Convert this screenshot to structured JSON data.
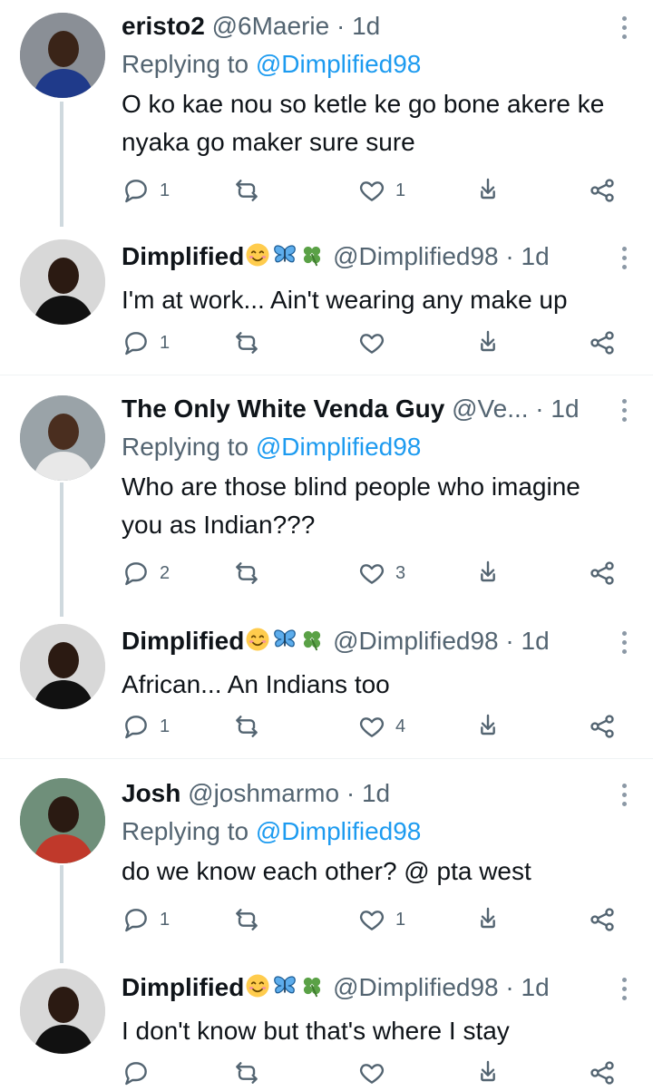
{
  "replying_label": "Replying to",
  "tweets": [
    {
      "name": "eristo2",
      "emojis": [],
      "handle": "@6Maerie",
      "time": "1d",
      "reply_to": "@Dimplified98",
      "text": "O ko kae nou so ketle ke go bone akere ke nyaka go maker sure sure",
      "replies": "1",
      "retweets": "",
      "likes": "1",
      "avatar": {
        "bg": "#8a8f96",
        "skin": "#3a2418",
        "shirt": "#1f3a8a"
      }
    },
    {
      "name": "Dimplified",
      "emojis": [
        "smiling-face-emoji",
        "butterfly-emoji",
        "four-leaf-clover-emoji"
      ],
      "handle": "@Dimplified98",
      "time": "1d",
      "reply_to": "",
      "text": "I'm at work... Ain't wearing any make up",
      "replies": "1",
      "retweets": "",
      "likes": "",
      "avatar": {
        "bg": "#d8d8d8",
        "skin": "#2b1a12",
        "shirt": "#111111"
      }
    },
    {
      "name": "The Only White Venda Guy",
      "emojis": [],
      "handle": "@Ve...",
      "time": "1d",
      "reply_to": "@Dimplified98",
      "text": "Who are those blind people who imagine you as Indian???",
      "replies": "2",
      "retweets": "",
      "likes": "3",
      "avatar": {
        "bg": "#9aa3a8",
        "skin": "#4a2e1f",
        "shirt": "#e8e8e8"
      }
    },
    {
      "name": "Dimplified",
      "emojis": [
        "smiling-face-emoji",
        "butterfly-emoji",
        "four-leaf-clover-emoji"
      ],
      "handle": "@Dimplified98",
      "time": "1d",
      "reply_to": "",
      "text": "African... An Indians too",
      "replies": "1",
      "retweets": "",
      "likes": "4",
      "avatar": {
        "bg": "#d8d8d8",
        "skin": "#2b1a12",
        "shirt": "#111111"
      }
    },
    {
      "name": "Josh",
      "emojis": [],
      "handle": "@joshmarmo",
      "time": "1d",
      "reply_to": "@Dimplified98",
      "text": "do we know each other? @ pta west",
      "replies": "1",
      "retweets": "",
      "likes": "1",
      "avatar": {
        "bg": "#6f8f7a",
        "skin": "#2a1a12",
        "shirt": "#c0392b"
      }
    },
    {
      "name": "Dimplified",
      "emojis": [
        "smiling-face-emoji",
        "butterfly-emoji",
        "four-leaf-clover-emoji"
      ],
      "handle": "@Dimplified98",
      "time": "1d",
      "reply_to": "",
      "text": "I don't know but that's where I stay",
      "replies": "",
      "retweets": "",
      "likes": "",
      "avatar": {
        "bg": "#d8d8d8",
        "skin": "#2b1a12",
        "shirt": "#111111"
      }
    }
  ],
  "colors": {
    "accent": "#1d9bf0",
    "secondary_text": "#536471",
    "thread_line": "#cfd9de"
  }
}
